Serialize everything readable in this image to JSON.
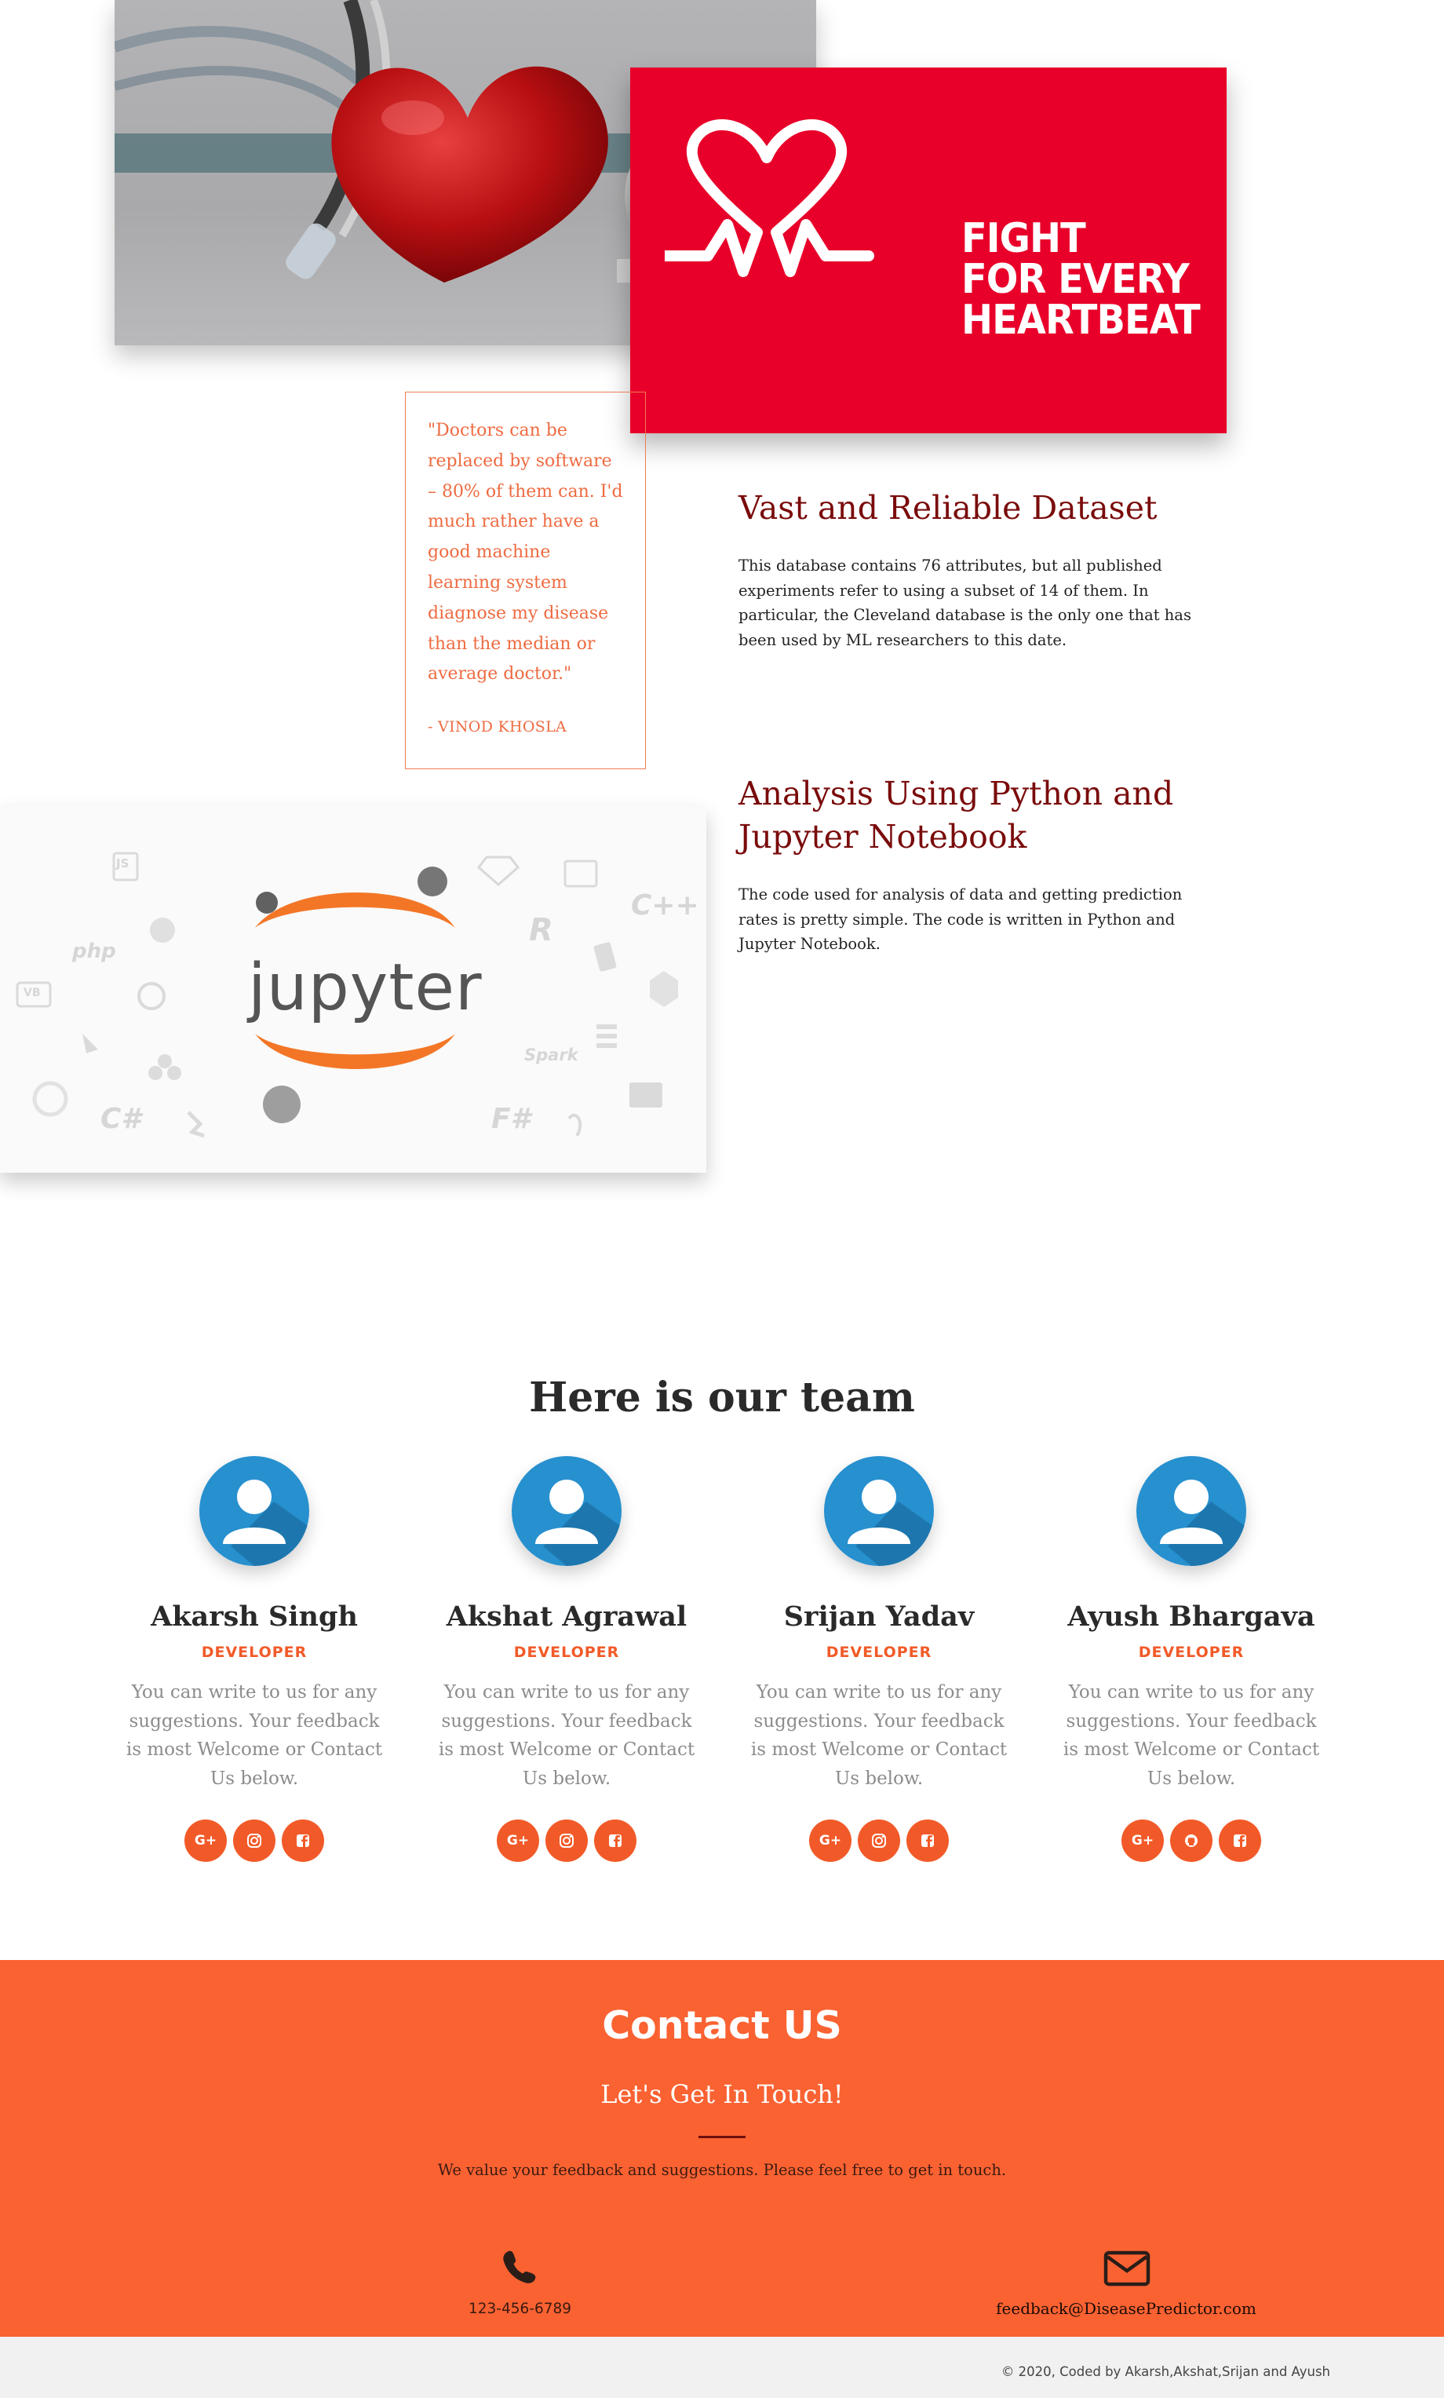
{
  "hero": {
    "banner_lines": "FIGHT\nFOR EVERY\nHEARTBEAT"
  },
  "quote": {
    "text": "\"Doctors can be replaced by software – 80% of them can. I'd much rather have a good machine learning system diagnose my disease than the median or average doctor.\"",
    "author": "- VINOD KHOSLA"
  },
  "features": [
    {
      "title": "Vast and Reliable Dataset",
      "body": "This database contains 76 attributes, but all published experiments refer to using a subset of 14 of them. In particular, the Cleveland database is the only one that has been used by ML researchers to this date."
    },
    {
      "title": "Analysis Using Python and Jupyter Notebook",
      "body": "The code used for analysis of data and getting prediction rates is pretty simple. The code is written in Python and Jupyter Notebook."
    }
  ],
  "jupyter": {
    "wordmark": "jupyter",
    "glyphs": [
      "php",
      "C#",
      "C++",
      "F#",
      "Spark",
      "R",
      "JS",
      "VB"
    ]
  },
  "team": {
    "title": "Here is our team",
    "members": [
      {
        "name": "Akarsh Singh",
        "role": "DEVELOPER",
        "desc": "You can write to us for any suggestions. Your feedback is most Welcome or Contact Us below.",
        "socials": [
          "G+",
          "instagram",
          "facebook"
        ]
      },
      {
        "name": "Akshat Agrawal",
        "role": "DEVELOPER",
        "desc": "You can write to us for any suggestions. Your feedback is most Welcome or Contact Us below.",
        "socials": [
          "G+",
          "instagram",
          "facebook"
        ]
      },
      {
        "name": "Srijan Yadav",
        "role": "DEVELOPER",
        "desc": "You can write to us for any suggestions. Your feedback is most Welcome or Contact Us below.",
        "socials": [
          "G+",
          "instagram",
          "facebook"
        ]
      },
      {
        "name": "Ayush Bhargava",
        "role": "DEVELOPER",
        "desc": "You can write to us for any suggestions. Your feedback is most Welcome or Contact Us below.",
        "socials": [
          "G+",
          "github",
          "facebook"
        ]
      }
    ],
    "social_plus_label": "G+"
  },
  "contact": {
    "title": "Contact US",
    "subtitle": "Let's Get In Touch!",
    "message": "We value your feedback and suggestions. Please feel free to get in touch.",
    "phone": "123-456-6789",
    "email": "feedback@DiseasePredictor.com"
  },
  "footer": {
    "text": "© 2020, Coded by Akarsh,Akshat,Srijan and Ayush"
  },
  "colors": {
    "accent": "#f15a28",
    "contact_bg": "#fa6232",
    "bhf_red": "#e8002a",
    "heading_maroon": "#7a0b0b",
    "avatar_blue": "#2790cf"
  }
}
